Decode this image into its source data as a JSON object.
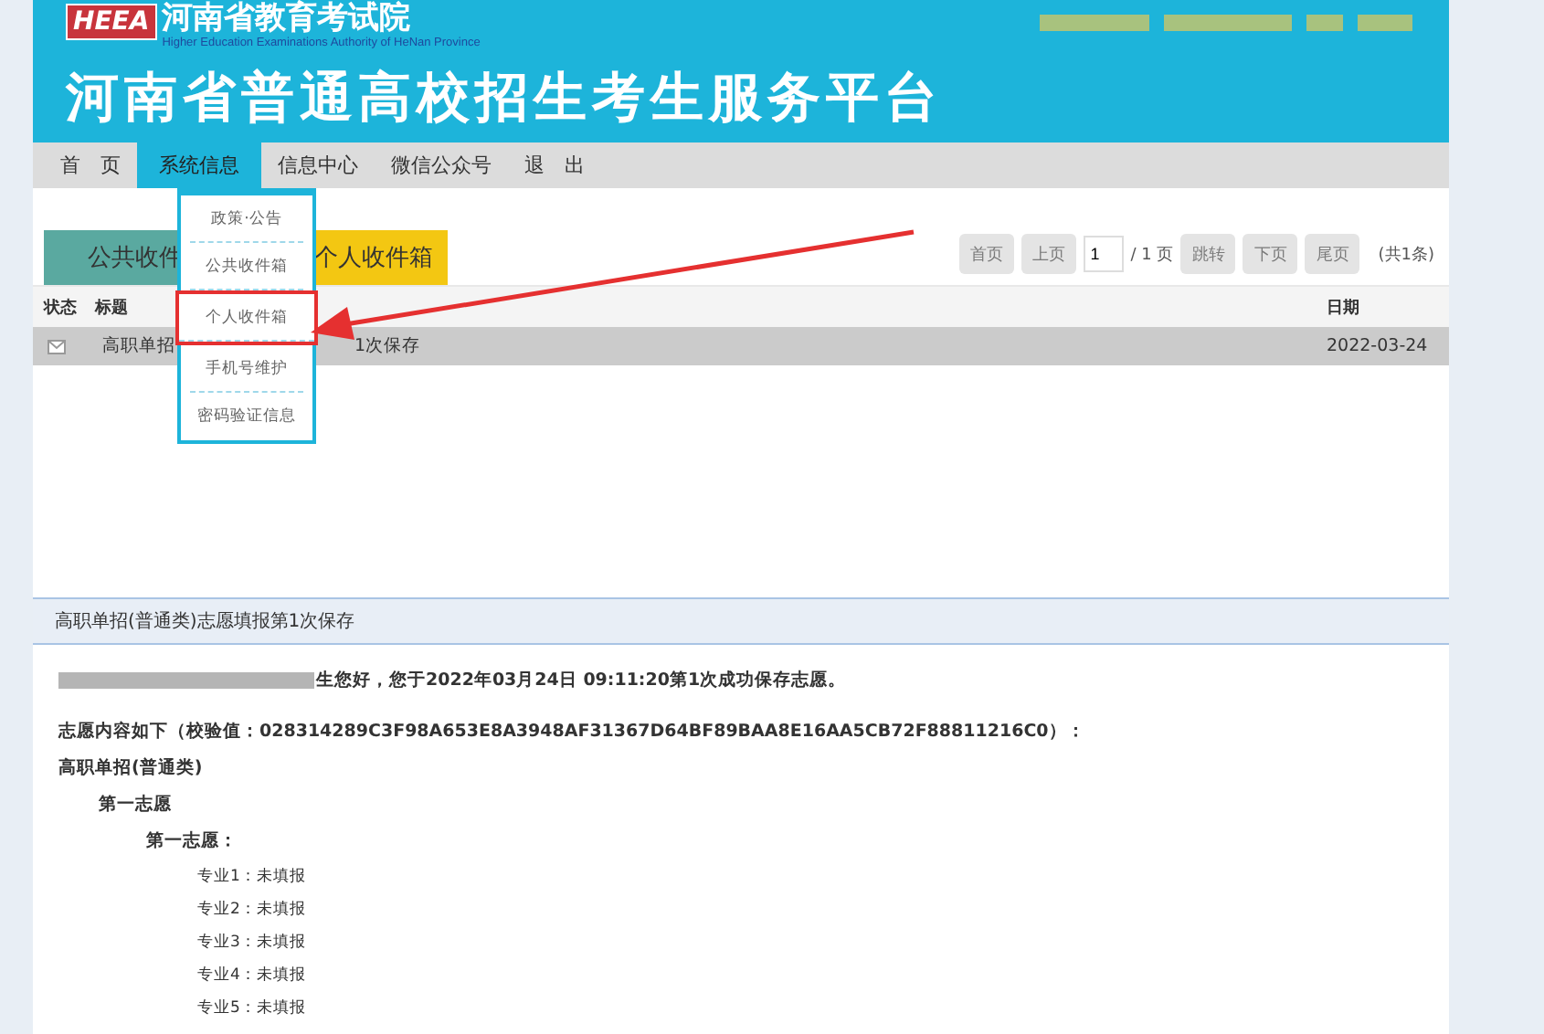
{
  "header": {
    "logo": "HEEA",
    "org": "河南省教育考试院",
    "org_en": "Higher Education Examinations Authority of HeNan Province",
    "title": "河南省普通高校招生考生服务平台"
  },
  "nav": [
    {
      "label": "首　页",
      "selected": false
    },
    {
      "label": "系统信息",
      "selected": true
    },
    {
      "label": "信息中心",
      "selected": false
    },
    {
      "label": "微信公众号",
      "selected": false
    },
    {
      "label": "退　出",
      "selected": false
    }
  ],
  "dropdown": [
    {
      "label": "政策·公告",
      "highlighted": false
    },
    {
      "label": "公共收件箱",
      "highlighted": false
    },
    {
      "label": "个人收件箱",
      "highlighted": true
    },
    {
      "label": "手机号维护",
      "highlighted": false
    },
    {
      "label": "密码验证信息",
      "highlighted": false
    }
  ],
  "mailbox_tabs": [
    {
      "label": "公共收件",
      "selected": false
    },
    {
      "label": "个人收件箱",
      "selected": true
    }
  ],
  "pager": {
    "first": "首页",
    "prev": "上页",
    "page": "1",
    "total": "/ 1 页",
    "go": "跳转",
    "next": "下页",
    "last": "尾页",
    "count": "(共1条)"
  },
  "table": {
    "columns": [
      "状态",
      "标题",
      "日期"
    ],
    "rows": [
      {
        "title": "高职单招",
        "title_tail": "1次保存",
        "date": "2022-03-24",
        "selected": true
      }
    ]
  },
  "message": {
    "heading": "高职单招(普通类)志愿填报第1次保存",
    "greeting": "生您好，您于2022年03月24日 09:11:20第1次成功保存志愿。",
    "content_intro": "志愿内容如下（校验值：028314289C3F98A653E8A3948AF31367D64BF89BAA8E16AA5CB72F88811216C0）：",
    "category": "高职单招(普通类)",
    "choice_group": "第一志愿",
    "choice": "第一志愿：",
    "majors": [
      "专业1：未填报",
      "专业2：未填报",
      "专业3：未填报",
      "专业4：未填报",
      "专业5：未填报"
    ]
  }
}
